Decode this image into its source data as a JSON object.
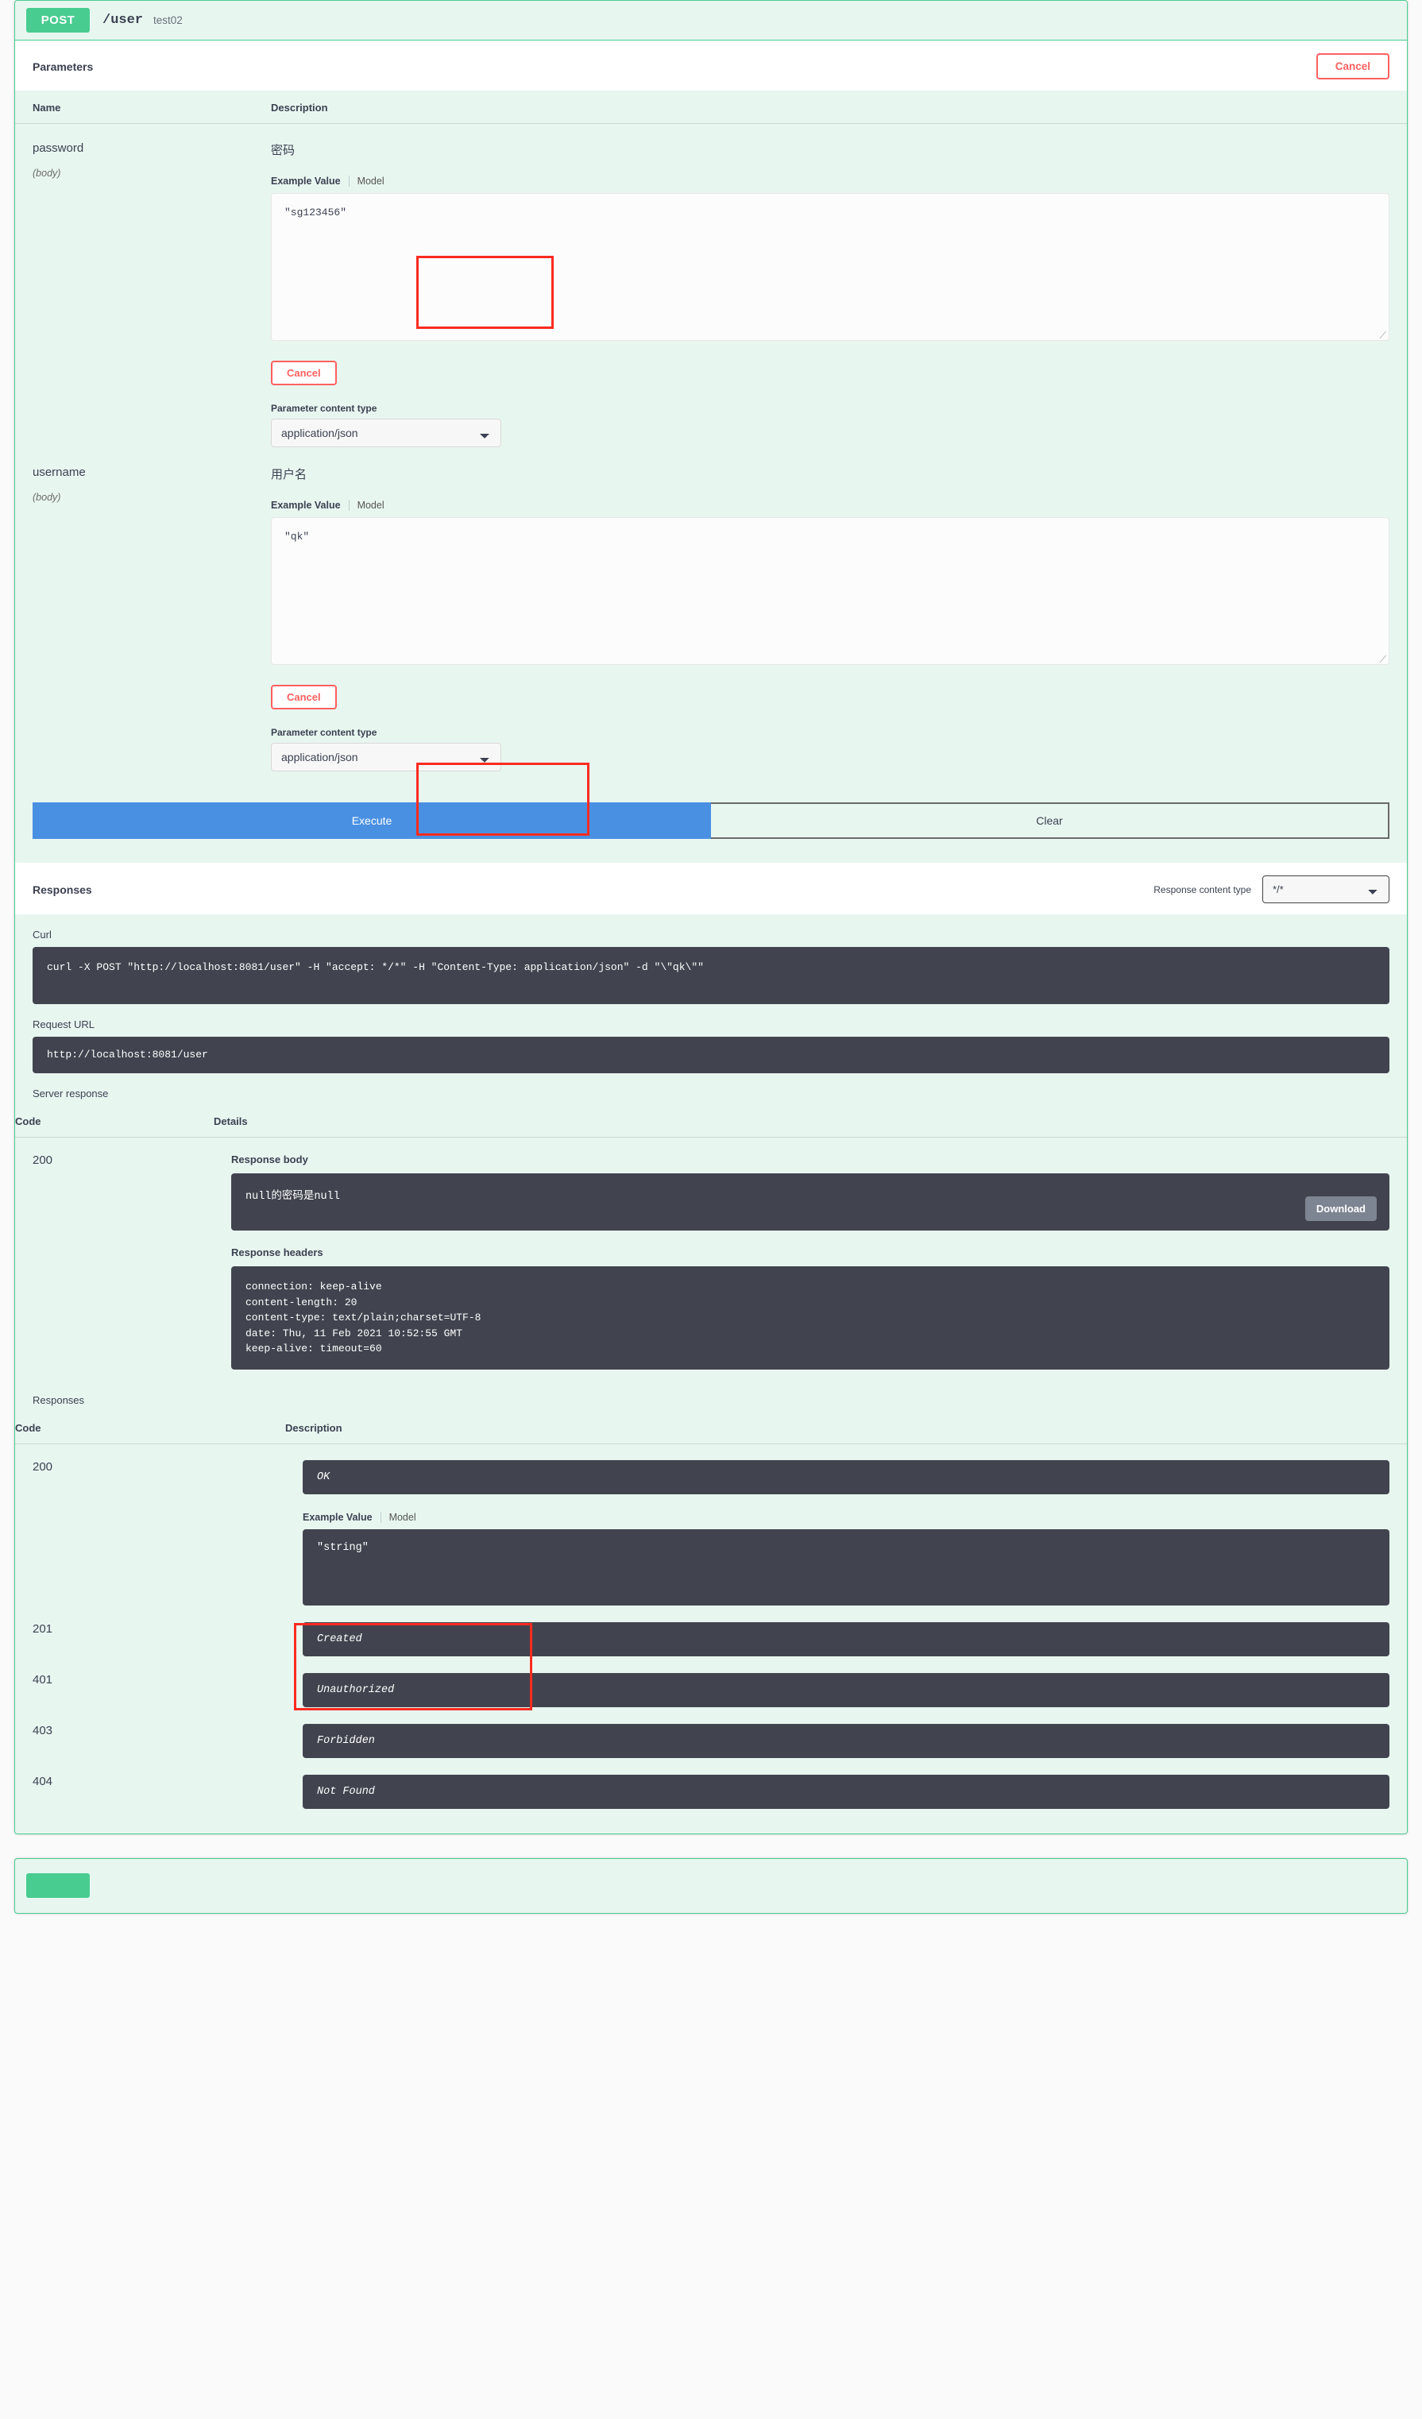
{
  "operation": {
    "method": "POST",
    "path": "/user",
    "summary": "test02"
  },
  "parameters_section": {
    "title": "Parameters",
    "cancel_label": "Cancel",
    "columns": {
      "name": "Name",
      "description": "Description"
    },
    "rows": [
      {
        "name": "password",
        "in": "(body)",
        "description": "密码",
        "tabs": {
          "example": "Example Value",
          "model": "Model"
        },
        "editor_value": "\"sg123456\"",
        "cancel_label": "Cancel",
        "content_type_label": "Parameter content type",
        "content_type_value": "application/json",
        "content_type_options": [
          "application/json"
        ]
      },
      {
        "name": "username",
        "in": "(body)",
        "description": "用户名",
        "tabs": {
          "example": "Example Value",
          "model": "Model"
        },
        "editor_value": "\"qk\"",
        "cancel_label": "Cancel",
        "content_type_label": "Parameter content type",
        "content_type_value": "application/json",
        "content_type_options": [
          "application/json"
        ]
      }
    ],
    "execute_label": "Execute",
    "clear_label": "Clear"
  },
  "responses_section": {
    "title": "Responses",
    "response_content_type_label": "Response content type",
    "response_content_type_value": "*/*",
    "response_content_type_options": [
      "*/*"
    ],
    "curl_label": "Curl",
    "curl_command": "curl -X POST \"http://localhost:8081/user\" -H \"accept: */*\" -H \"Content-Type: application/json\" -d \"\\\"qk\\\"\"",
    "request_url_label": "Request URL",
    "request_url": "http://localhost:8081/user",
    "server_response_label": "Server response",
    "server_columns": {
      "code": "Code",
      "details": "Details"
    },
    "server_code": "200",
    "response_body_label": "Response body",
    "response_body": "null的密码是null",
    "download_label": "Download",
    "response_headers_label": "Response headers",
    "response_headers": "connection: keep-alive \ncontent-length: 20 \ncontent-type: text/plain;charset=UTF-8 \ndate: Thu, 11 Feb 2021 10:52:55 GMT \nkeep-alive: timeout=60"
  },
  "response_codes_section": {
    "title": "Responses",
    "columns": {
      "code": "Code",
      "description": "Description"
    },
    "rows": [
      {
        "code": "200",
        "description": "OK",
        "tabs": {
          "example": "Example Value",
          "model": "Model"
        },
        "example_value": "\"string\""
      },
      {
        "code": "201",
        "description": "Created"
      },
      {
        "code": "401",
        "description": "Unauthorized"
      },
      {
        "code": "403",
        "description": "Forbidden"
      },
      {
        "code": "404",
        "description": "Not Found"
      }
    ]
  },
  "colors": {
    "post_green": "#49cc90",
    "block_bg": "#e8f6f0",
    "execute_blue": "#4990e2",
    "cancel_red": "#ff6060",
    "code_bg": "#41444e",
    "annotation_red": "#fc2b20"
  }
}
